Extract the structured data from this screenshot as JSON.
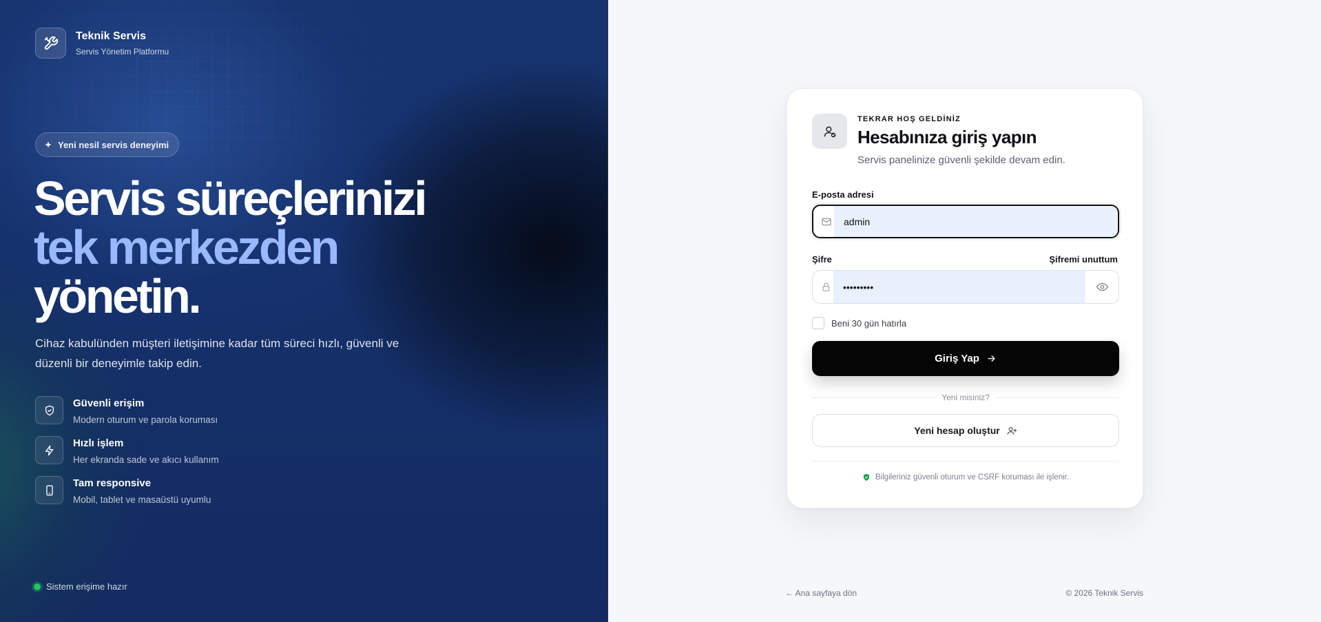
{
  "brand": {
    "title": "Teknik Servis",
    "subtitle": "Servis Yönetim Platformu",
    "logo_icon": "tools-icon"
  },
  "hero": {
    "badge": "Yeni nesil servis deneyimi",
    "headline_line1": "Servis süreçlerinizi",
    "headline_line2": "tek merkezden",
    "headline_line3": "yönetin.",
    "lead": "Cihaz kabulünden müşteri iletişimine kadar tüm süreci hızlı, güvenli ve düzenli bir deneyimle takip edin.",
    "accent_color": "#9ab8ff",
    "features": [
      {
        "icon": "shield-check-icon",
        "title": "Güvenli erişim",
        "desc": "Modern oturum ve parola koruması"
      },
      {
        "icon": "bolt-icon",
        "title": "Hızlı işlem",
        "desc": "Her ekranda sade ve akıcı kullanım"
      },
      {
        "icon": "smartphone-icon",
        "title": "Tam responsive",
        "desc": "Mobil, tablet ve masaüstü uyumlu"
      }
    ],
    "status": "Sistem erişime hazır",
    "status_color": "#22c55e"
  },
  "login": {
    "eyebrow": "TEKRAR HOŞ GELDİNİZ",
    "title": "Hesabınıza giriş yapın",
    "subtitle": "Servis panelinize güvenli şekilde devam edin.",
    "email_label": "E-posta adresi",
    "email_value": "admin",
    "password_label": "Şifre",
    "password_value": "•••••••••",
    "forgot_label": "Şifremi unuttum",
    "remember_label": "Beni 30 gün hatırla",
    "remember_checked": false,
    "submit_label": "Giriş Yap",
    "separator": "Yeni misiniz?",
    "register_label": "Yeni hesap oluştur",
    "security_note": "Bilgileriniz güvenli oturum ve CSRF koruması ile işlenir."
  },
  "footer": {
    "back_link": "← Ana sayfaya dön",
    "copyright": "© 2026 Teknik Servis"
  }
}
